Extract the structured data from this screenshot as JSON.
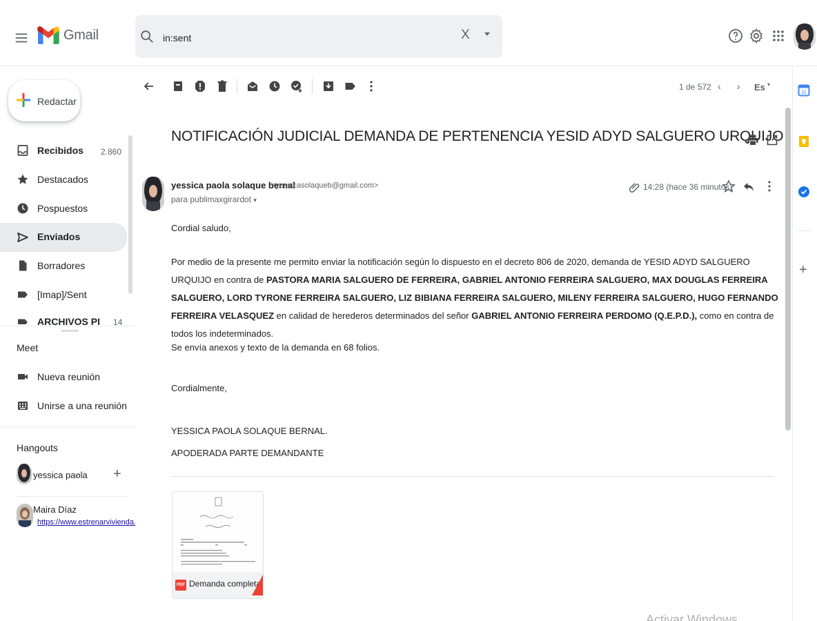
{
  "header": {
    "app_name": "Gmail",
    "search_value": "in:sent",
    "search_clear": "X"
  },
  "sidebar": {
    "compose_label": "Redactar",
    "items": [
      {
        "label": "Recibidos",
        "count": "2.860",
        "icon": "inbox-icon",
        "bold": true
      },
      {
        "label": "Destacados",
        "count": "",
        "icon": "star-icon"
      },
      {
        "label": "Pospuestos",
        "count": "",
        "icon": "clock-icon"
      },
      {
        "label": "Enviados",
        "count": "",
        "icon": "send-icon",
        "bold": true,
        "active": true
      },
      {
        "label": "Borradores",
        "count": "",
        "icon": "draft-icon"
      },
      {
        "label": "[Imap]/Sent",
        "count": "",
        "icon": "label-icon"
      },
      {
        "label": "ARCHIVOS PERSO...",
        "count": "14",
        "icon": "label-icon",
        "bold": true
      }
    ],
    "meet": {
      "title": "Meet",
      "new_meeting": "Nueva reunión",
      "join_meeting": "Unirse a una reunión"
    },
    "hangouts": {
      "title": "Hangouts",
      "current_user": "yessica paola",
      "contacts": [
        {
          "name": "Maira Díaz",
          "status": "https://www.estrenarvivienda.com/vi"
        }
      ]
    }
  },
  "toolbar": {
    "pager": "1 de 572",
    "language": "Es"
  },
  "message": {
    "subject": "NOTIFICACIÓN JUDICIAL DEMANDA DE PERTENENCIA YESID ADYD SALGUERO URQUIJO",
    "sender_name": "yessica paola solaque bernal",
    "sender_email": "<yessicasolaqueb@gmail.com>",
    "recipient": "para publimaxgirardot",
    "time": "14:28 (hace 36 minutos)",
    "greeting": "Cordial  saludo,",
    "paragraph_segments": [
      {
        "text": "Por  medio  de la presente me  permito  enviar la notificación según lo dispuesto  en el decreto 806 de  2020,  demanda  de YESID ADYD SALGUERO URQUIJO en contra de ",
        "bold": false
      },
      {
        "text": "PASTORA MARIA SALGUERO DE FERREIRA, GABRIEL ANTONIO FERREIRA SALGUERO, MAX DOUGLAS FERREIRA SALGUERO, LORD TYRONE FERREIRA SALGUERO, LIZ BIBIANA FERREIRA SALGUERO, MILENY FERREIRA SALGUERO, HUGO FERNANDO FERREIRA VELASQUEZ",
        "bold": true
      },
      {
        "text": " en calidad de herederos determinados del señor ",
        "bold": false
      },
      {
        "text": "GABRIEL ANTONIO FERREIRA PERDOMO (Q.E.P.D.),",
        "bold": true
      },
      {
        "text": " como en contra de todos los indeterminados.",
        "bold": false
      }
    ],
    "annex_line": "Se  envía anexos y  texto de la  demanda en 68 folios.",
    "closing": "Cordialmente,",
    "signature_name": "YESSICA PAOLA SOLAQUE BERNAL.",
    "signature_role": "APODERADA PARTE DEMANDANTE",
    "attachment": {
      "name": "Demanda completa...",
      "type_badge": "PDF"
    }
  },
  "watermark": "Activar Windows",
  "colors": {
    "gmail_red": "#EA4335",
    "gmail_blue": "#4285F4",
    "gmail_yellow": "#FBBC04",
    "gmail_green": "#34A853",
    "active_nav": "#e8eaed"
  }
}
